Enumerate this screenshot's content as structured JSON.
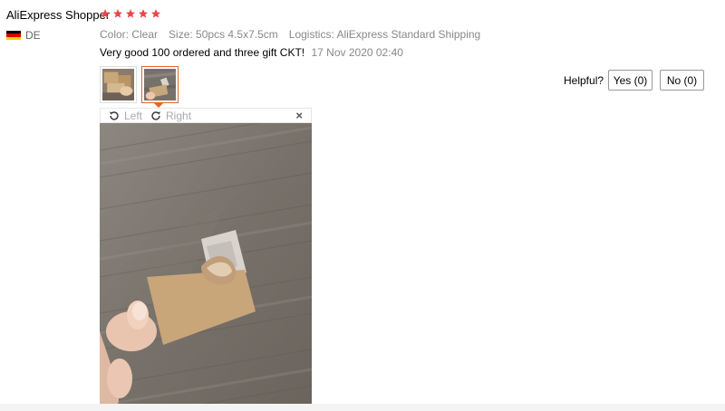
{
  "review": {
    "reviewer": "AliExpress Shopper",
    "rating": 5,
    "country_code": "DE",
    "color": "Color: Clear",
    "size": "Size: 50pcs 4.5x7.5cm",
    "logistics": "Logistics: AliExpress Standard Shipping",
    "text": "Very good 100 ordered and three gift CKT!",
    "date": "17 Nov 2020 02:40"
  },
  "helpful": {
    "label": "Helpful?",
    "yes": "Yes (0)",
    "no": "No (0)"
  },
  "viewer": {
    "rotate_left": "Left",
    "rotate_right": "Right",
    "close": "×"
  },
  "colors": {
    "star": "#e8474c",
    "accent": "#e2671f"
  }
}
